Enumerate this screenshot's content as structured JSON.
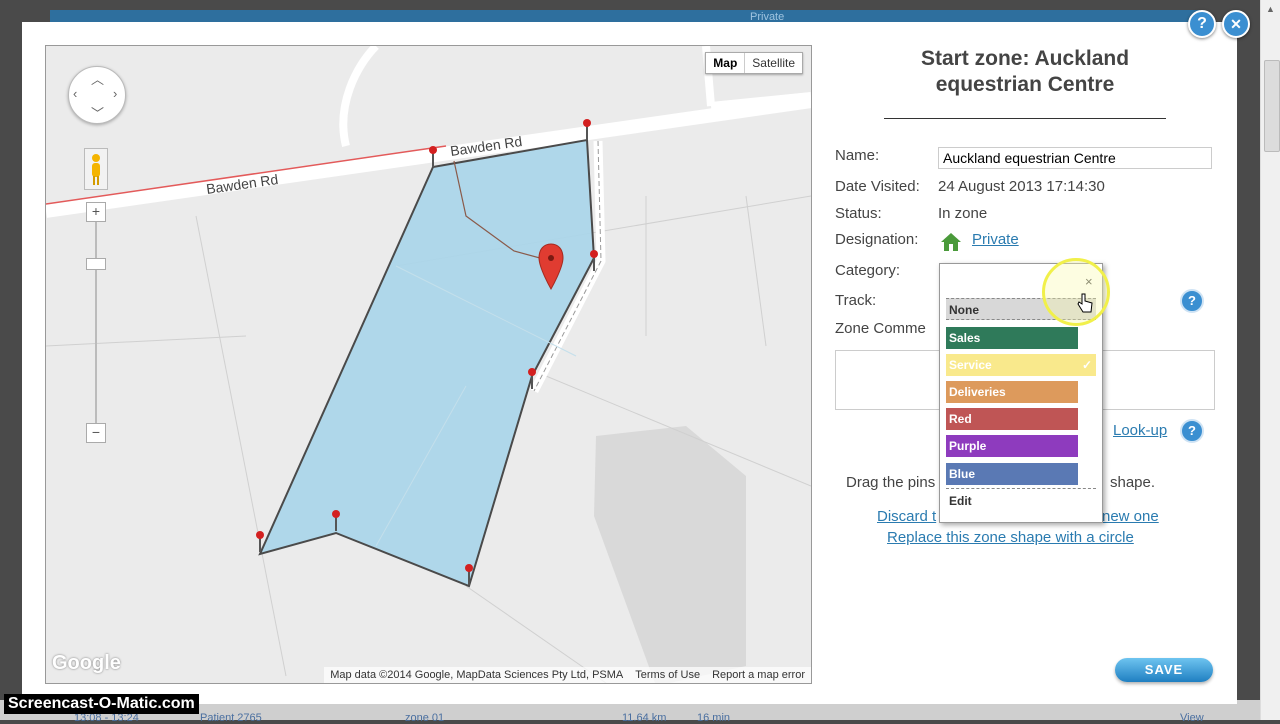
{
  "background": {
    "strip_text": "Private",
    "bottom_time": "13:08 - 13:24",
    "bottom_patient": "Patient 2765",
    "bottom_zone": "zone 01",
    "bottom_distance": "11.64 km",
    "bottom_duration": "16 min",
    "bottom_view": "View"
  },
  "dialog": {
    "help_icon": "?",
    "close_icon": "✕"
  },
  "map": {
    "type_buttons": [
      "Map",
      "Satellite"
    ],
    "road_label_1": "Bawden Rd",
    "road_label_2": "Bawden Rd",
    "zoom_in": "+",
    "zoom_out": "−",
    "logo": "Google",
    "footer": {
      "attribution": "Map data ©2014 Google, MapData Sciences Pty Ltd, PSMA",
      "terms": "Terms of Use",
      "report": "Report a map error"
    },
    "colors": {
      "zone_fill": "#a9d5ea",
      "zone_stroke": "#4a4a4a",
      "road": "#ffffff"
    }
  },
  "form": {
    "title": "Start zone: Auckland equestrian Centre",
    "labels": {
      "name": "Name:",
      "date": "Date Visited:",
      "status": "Status:",
      "designation": "Designation:",
      "category": "Category:",
      "track": "Track:",
      "comments": "Zone Comme"
    },
    "name_value": "Auckland equestrian Centre",
    "date_value": "24 August 2013 17:14:30",
    "status_value": "In zone",
    "designation_value": "Private",
    "lookup_link": "Look-up",
    "drag_text": "Drag the pins",
    "shape_text": "shape.",
    "discard_link": "Discard t",
    "new_one_link": "new one",
    "circle_link": "Replace this zone shape with a circle",
    "save_label": "SAVE"
  },
  "category_dropdown": {
    "close": "×",
    "items": [
      {
        "label": "None",
        "color": "#d8d8d8"
      },
      {
        "label": "Sales",
        "color": "#2f7a5a"
      },
      {
        "label": "Service",
        "color": "#f9e98c",
        "selected": true
      },
      {
        "label": "Deliveries",
        "color": "#dd9a5c"
      },
      {
        "label": "Red",
        "color": "#bf5555"
      },
      {
        "label": "Purple",
        "color": "#8e3bbe"
      },
      {
        "label": "Blue",
        "color": "#5a79b4"
      }
    ],
    "check": "✓",
    "edit_label": "Edit"
  },
  "watermark": "Screencast-O-Matic.com"
}
